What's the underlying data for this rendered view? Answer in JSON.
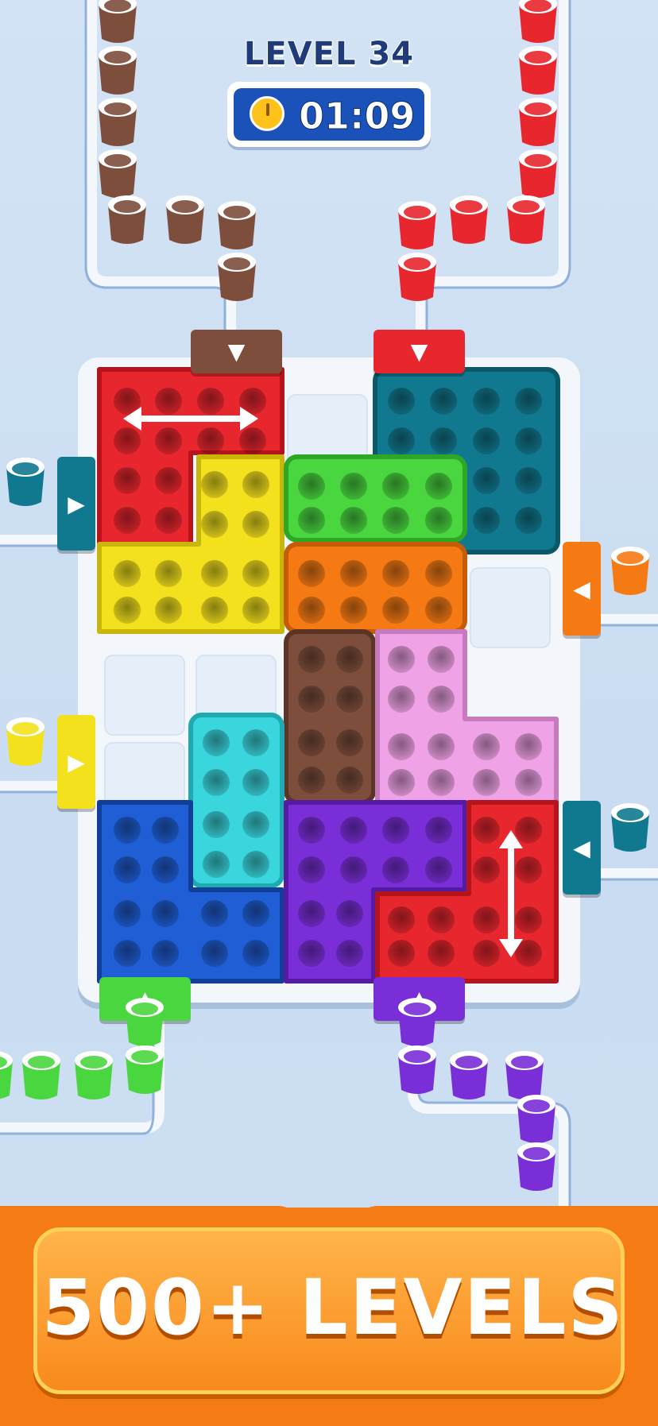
{
  "hud": {
    "level_label": "LEVEL 34",
    "timer": "01:09"
  },
  "banner": {
    "text": "500+ LEVELS"
  },
  "colors": {
    "red": "#e8262e",
    "teal": "#11798f",
    "yellow": "#f4e11e",
    "green": "#49d63f",
    "orange": "#f57a14",
    "brown": "#7e4e3c",
    "pink": "#f0a2e6",
    "cyan": "#3ad6de",
    "blue": "#1f5ed4",
    "purple": "#7a2ed8"
  },
  "pieces": [
    {
      "color": "red",
      "shape": "L",
      "arrow": "horizontal"
    },
    {
      "color": "teal",
      "shape": "square"
    },
    {
      "color": "yellow",
      "shape": "L"
    },
    {
      "color": "green",
      "shape": "bar"
    },
    {
      "color": "orange",
      "shape": "bar"
    },
    {
      "color": "brown",
      "shape": "bar"
    },
    {
      "color": "pink",
      "shape": "L"
    },
    {
      "color": "cyan",
      "shape": "bar"
    },
    {
      "color": "blue",
      "shape": "L"
    },
    {
      "color": "purple",
      "shape": "L"
    },
    {
      "color": "red",
      "shape": "L",
      "arrow": "vertical"
    }
  ],
  "gates": [
    {
      "color": "brown",
      "direction": "down"
    },
    {
      "color": "red",
      "direction": "down"
    },
    {
      "color": "teal",
      "direction": "right"
    },
    {
      "color": "orange",
      "direction": "left"
    },
    {
      "color": "yellow",
      "direction": "right"
    },
    {
      "color": "teal",
      "direction": "left"
    },
    {
      "color": "green",
      "direction": "up"
    },
    {
      "color": "purple",
      "direction": "up"
    }
  ]
}
